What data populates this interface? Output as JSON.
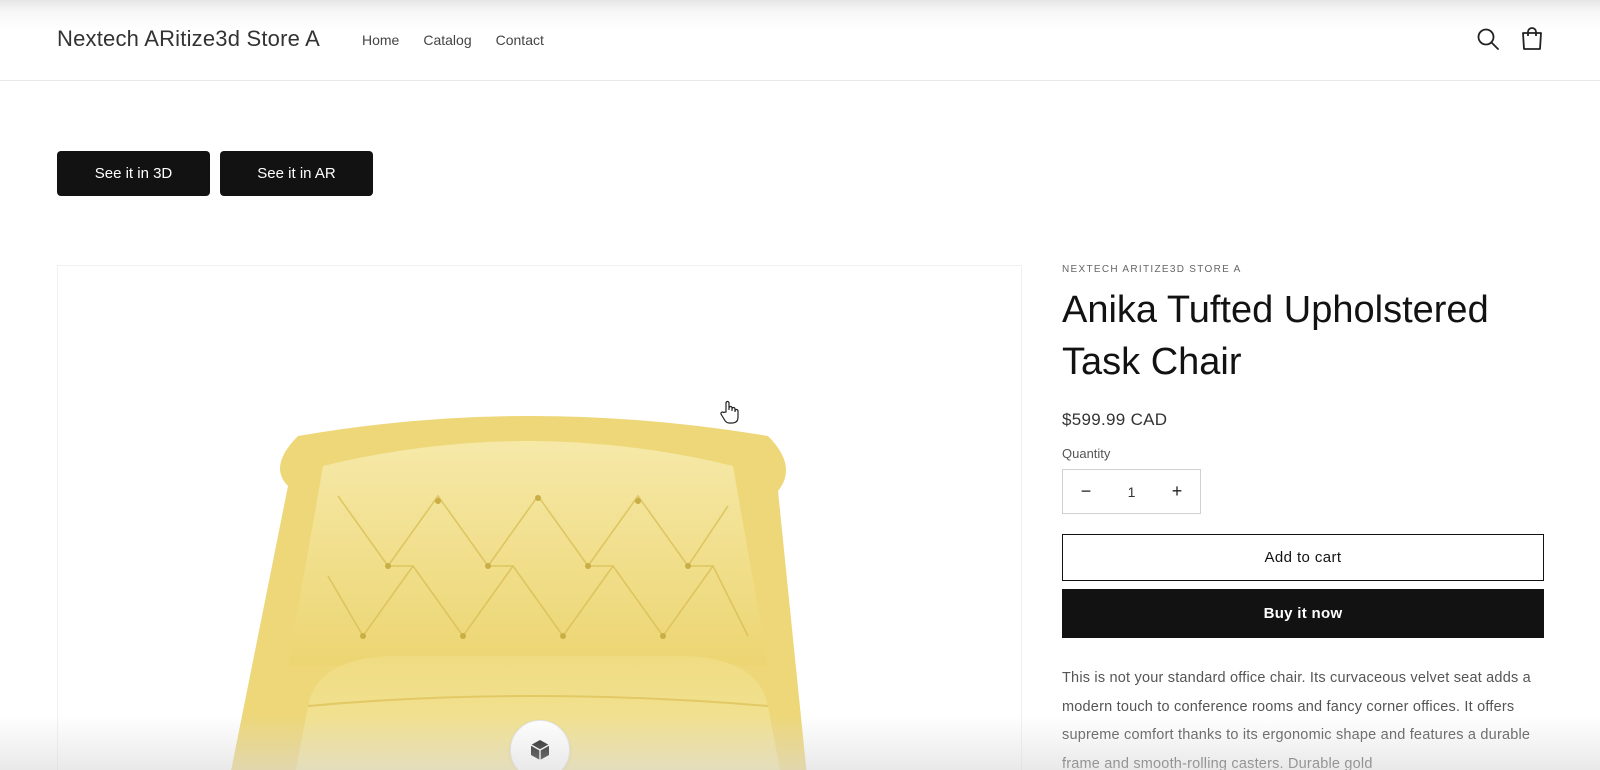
{
  "header": {
    "store_name": "Nextech ARitize3d Store A",
    "nav": [
      "Home",
      "Catalog",
      "Contact"
    ],
    "icons": [
      "search-icon",
      "cart-icon"
    ]
  },
  "view_buttons": {
    "see_3d": "See it in 3D",
    "see_ar": "See it in AR"
  },
  "product": {
    "vendor": "NEXTECH ARITIZE3D STORE A",
    "title": "Anika Tufted Upholstered Task Chair",
    "price": "$599.99 CAD",
    "quantity_label": "Quantity",
    "quantity_value": "1",
    "decrease_symbol": "−",
    "increase_symbol": "+",
    "add_to_cart": "Add to cart",
    "buy_now": "Buy it now",
    "description": "This is not your standard office chair. Its curvaceous velvet seat adds a modern touch to conference rooms and fancy corner offices. It offers supreme comfort thanks to its ergonomic shape and features a durable frame and smooth-rolling casters. Durable gold"
  },
  "media": {
    "image": "yellow tufted chair",
    "badge_icon": "3d-cube-icon"
  },
  "colors": {
    "primary": "#121212",
    "chair": "#f1de8a",
    "text_muted": "#555555"
  }
}
